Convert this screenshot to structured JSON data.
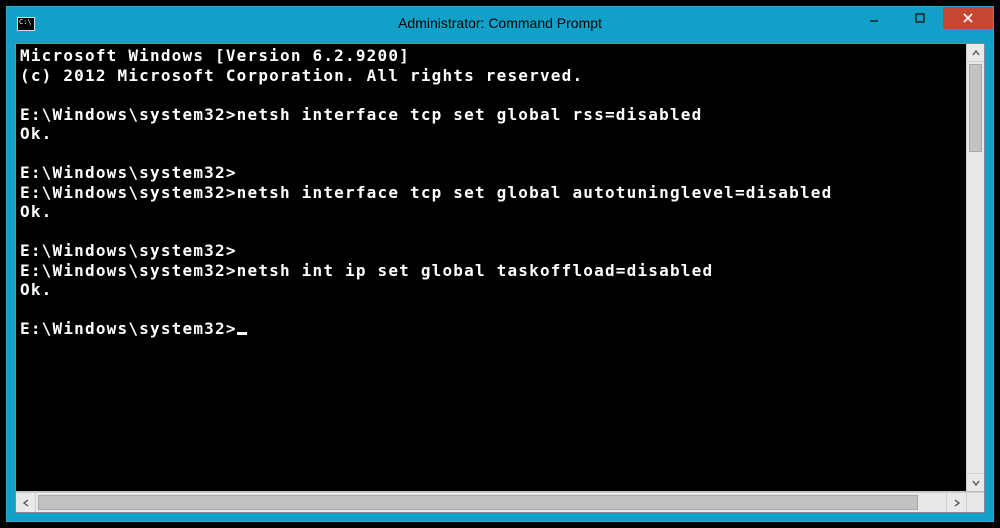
{
  "window": {
    "title": "Administrator: Command Prompt"
  },
  "console": {
    "header_line1": "Microsoft Windows [Version 6.2.9200]",
    "header_line2": "(c) 2012 Microsoft Corporation. All rights reserved.",
    "blank": "",
    "prompt": "E:\\Windows\\system32>",
    "cmd1": "netsh interface tcp set global rss=disabled",
    "ok": "Ok.",
    "cmd2": "netsh interface tcp set global autotuninglevel=disabled",
    "cmd3": "netsh int ip set global taskoffload=disabled"
  }
}
